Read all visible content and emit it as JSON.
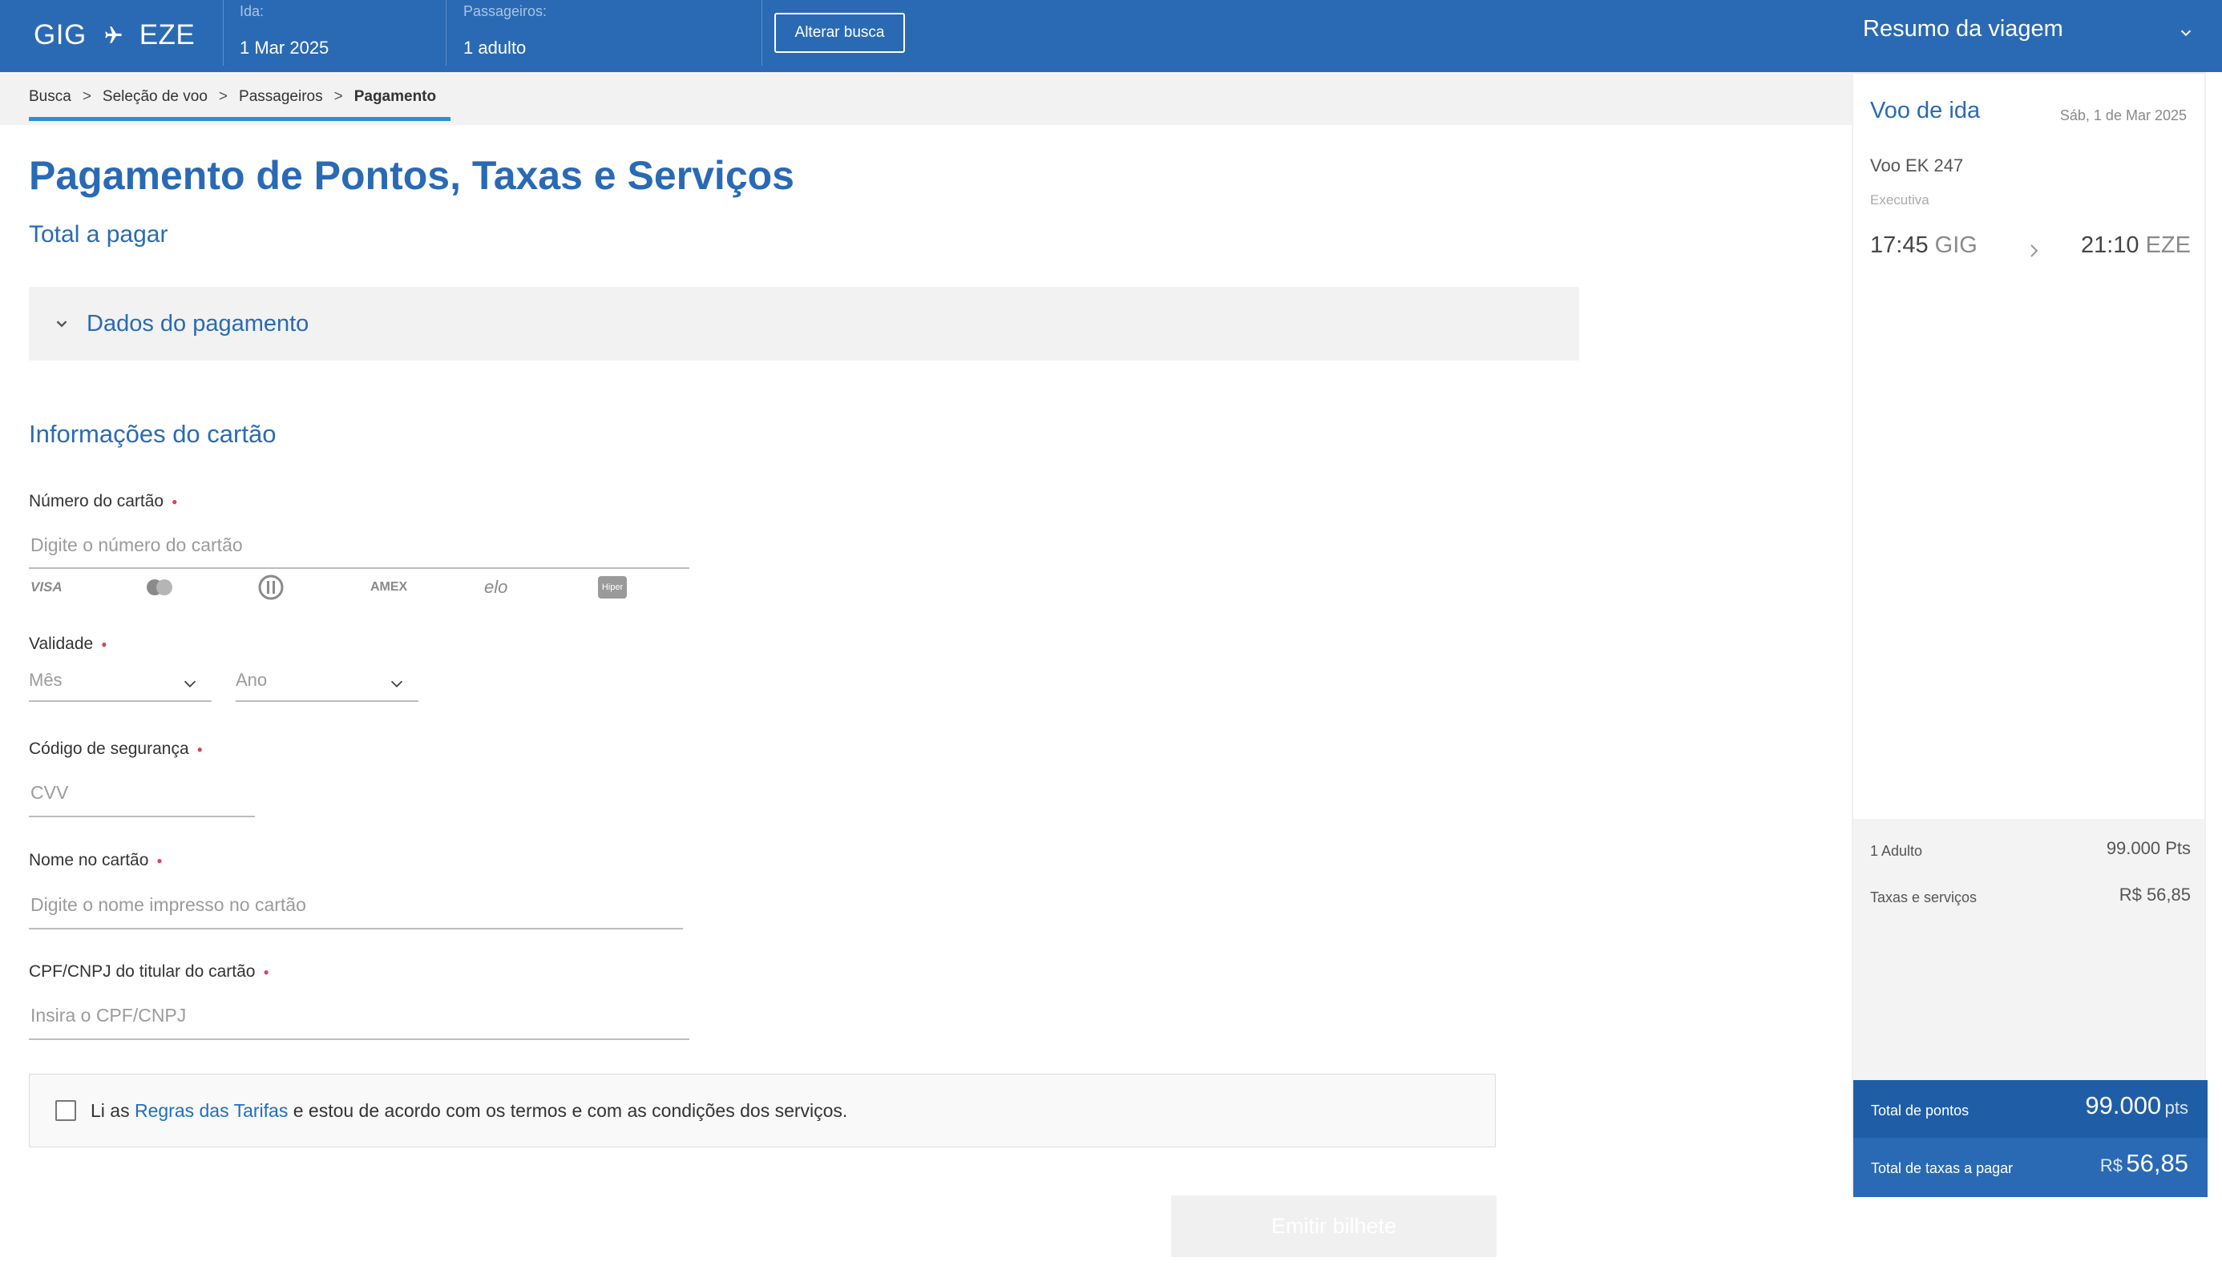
{
  "header": {
    "origin": "GIG",
    "destination": "EZE",
    "ida_label": "Ida:",
    "ida_value": "1 Mar 2025",
    "passengers_label": "Passageiros:",
    "passengers_value": "1 adulto",
    "alter_button": "Alterar busca",
    "summary_toggle": "Resumo da viagem"
  },
  "breadcrumb": [
    "Busca",
    "Seleção de voo",
    "Passageiros",
    "Pagamento"
  ],
  "breadcrumb_separator": ">",
  "page": {
    "title": "Pagamento de Pontos, Taxas e Serviços",
    "total_label": "Total a pagar",
    "payment_panel": "Dados do pagamento",
    "card_section": "Informações do cartão"
  },
  "form": {
    "card_number_label": "Número do cartão",
    "card_number_placeholder": "Digite o número do cartão",
    "brands": [
      "VISA",
      "mastercard-icon",
      "diners-icon",
      "AMEX",
      "elo",
      "Hiper"
    ],
    "validity_label": "Validade",
    "month_placeholder": "Mês",
    "year_placeholder": "Ano",
    "cvv_label": "Código de segurança",
    "cvv_placeholder": "CVV",
    "name_label": "Nome no cartão",
    "name_placeholder": "Digite o nome impresso no cartão",
    "cpf_label": "CPF/CNPJ do titular do cartão",
    "cpf_placeholder": "Insira o CPF/CNPJ",
    "terms_before": "Li as ",
    "terms_link": "Regras das Tarifas",
    "terms_after": " e estou de acordo com os termos e com as condições dos serviços.",
    "terms_checked": false,
    "submit_button": "Emitir bilhete"
  },
  "summary": {
    "flight_title": "Voo de ida",
    "flight_date": "Sáb, 1 de Mar 2025",
    "flight_number": "Voo EK 247",
    "cabin": "Executiva",
    "dep_time": "17:45",
    "dep_city": "GIG",
    "arr_time": "21:10",
    "arr_city": "EZE",
    "adult_label": "1 Adulto",
    "adult_points": "99.000 Pts",
    "taxes_label": "Taxas e serviços",
    "taxes_value": "R$ 56,85",
    "total_points_label": "Total de pontos",
    "total_points_value": "99.000",
    "total_points_unit": "pts",
    "total_taxes_label": "Total de taxas a pagar",
    "total_taxes_currency": "R$",
    "total_taxes_value": "56,85"
  },
  "colors": {
    "brand_blue": "#2a6ab4",
    "link_blue": "#1f6dc2",
    "required_dot": "#d9415f",
    "panel_grey": "#f2f2f2"
  }
}
